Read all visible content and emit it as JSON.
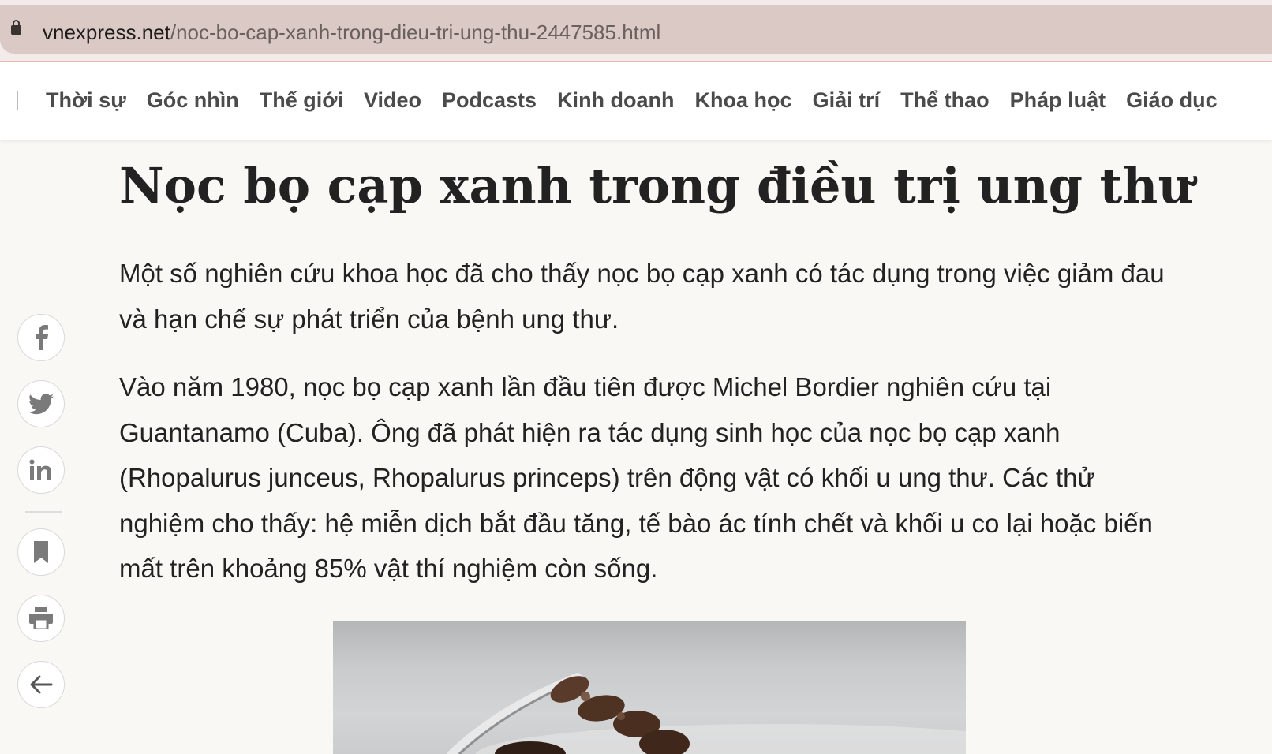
{
  "browser": {
    "url_host": "vnexpress.net",
    "url_path": "/noc-bo-cap-xanh-trong-dieu-tri-ung-thu-2447585.html"
  },
  "nav": {
    "items": [
      "Thời sự",
      "Góc nhìn",
      "Thế giới",
      "Video",
      "Podcasts",
      "Kinh doanh",
      "Khoa học",
      "Giải trí",
      "Thể thao",
      "Pháp luật",
      "Giáo dục"
    ]
  },
  "social": {
    "icons": [
      "facebook-icon",
      "twitter-icon",
      "linkedin-icon",
      "bookmark-icon",
      "print-icon",
      "back-arrow-icon"
    ]
  },
  "article": {
    "title": "Nọc bọ cạp xanh trong điều trị ung thư",
    "description": "Một số nghiên cứu khoa học đã cho thấy nọc bọ cạp xanh có tác dụng trong việc giảm đau và hạn chế sự phát triển của bệnh ung thư.",
    "paragraph1": "Vào năm 1980, nọc bọ cạp xanh lần đầu tiên được Michel Bordier nghiên cứu tại Guantanamo (Cuba). Ông đã phát hiện ra tác dụng sinh học của nọc bọ cạp xanh (Rhopalurus junceus, Rhopalurus princeps) trên động vật có khối u ung thư. Các thử nghiệm cho thấy: hệ miễn dịch bắt đầu tăng, tế bào ác tính chết và khối u co lại hoặc biến mất trên khoảng 85% vật thí nghiệm còn sống."
  }
}
